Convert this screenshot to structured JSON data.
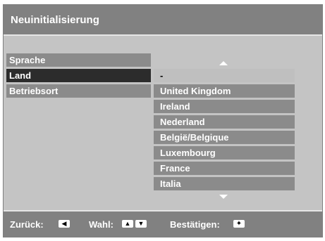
{
  "title": "Neuinitialisierung",
  "menu": {
    "items": [
      {
        "label": "Sprache"
      },
      {
        "label": "Land"
      },
      {
        "label": "Betriebsort"
      }
    ],
    "selected_index": 1
  },
  "country_list": {
    "items": [
      "-",
      "United Kingdom",
      "Ireland",
      "Nederland",
      "België/Belgique",
      "Luxembourg",
      "France",
      "Italia"
    ],
    "selected_index": 0
  },
  "footer": {
    "back_label": "Zurück:",
    "select_label": "Wahl:",
    "confirm_label": "Bestätigen:"
  },
  "icons": {
    "back": "left-arrow-key-icon",
    "select_up": "up-arrow-key-icon",
    "select_down": "down-arrow-key-icon",
    "confirm": "four-way-pad-icon",
    "scroll_up": "scroll-up-arrow-icon",
    "scroll_down": "scroll-down-arrow-icon"
  },
  "colors": {
    "panel_background": "#c4c4c4",
    "bar_background": "#818181",
    "item_background": "#8b8b8b",
    "menu_selected": "#2c2c2c",
    "list_selected": "#bfbfbf"
  }
}
